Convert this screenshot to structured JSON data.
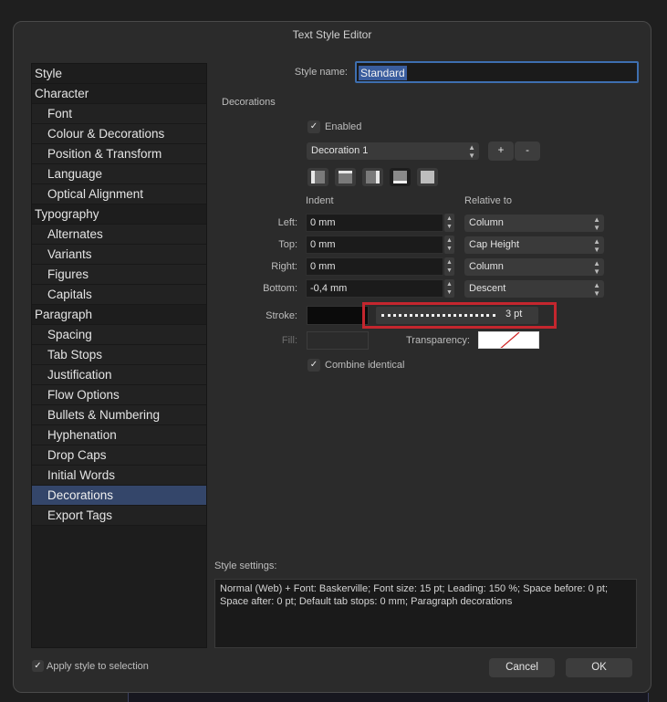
{
  "dialog": {
    "title": "Text Style Editor"
  },
  "sidebar": {
    "items": [
      {
        "label": "Style",
        "sub": false
      },
      {
        "label": "Character",
        "sub": false
      },
      {
        "label": "Font",
        "sub": true
      },
      {
        "label": "Colour & Decorations",
        "sub": true
      },
      {
        "label": "Position & Transform",
        "sub": true
      },
      {
        "label": "Language",
        "sub": true
      },
      {
        "label": "Optical Alignment",
        "sub": true
      },
      {
        "label": "Typography",
        "sub": false
      },
      {
        "label": "Alternates",
        "sub": true
      },
      {
        "label": "Variants",
        "sub": true
      },
      {
        "label": "Figures",
        "sub": true
      },
      {
        "label": "Capitals",
        "sub": true
      },
      {
        "label": "Paragraph",
        "sub": false
      },
      {
        "label": "Spacing",
        "sub": true
      },
      {
        "label": "Tab Stops",
        "sub": true
      },
      {
        "label": "Justification",
        "sub": true
      },
      {
        "label": "Flow Options",
        "sub": true
      },
      {
        "label": "Bullets & Numbering",
        "sub": true
      },
      {
        "label": "Hyphenation",
        "sub": true
      },
      {
        "label": "Drop Caps",
        "sub": true
      },
      {
        "label": "Initial Words",
        "sub": true
      },
      {
        "label": "Decorations",
        "sub": true,
        "selected": true
      },
      {
        "label": "Export Tags",
        "sub": true
      }
    ]
  },
  "style_name": {
    "label": "Style name:",
    "value": "Standard"
  },
  "decorations": {
    "section_label": "Decorations",
    "enabled_label": "Enabled",
    "enabled": true,
    "decoration_select": "Decoration 1",
    "add_label": "+",
    "remove_label": "-",
    "alignment_buttons": [
      "left",
      "top",
      "right",
      "bottom",
      "fill"
    ],
    "active_alignment": "bottom",
    "indent_header": "Indent",
    "relative_header": "Relative to",
    "rows": [
      {
        "label": "Left:",
        "value": "0 mm",
        "relative": "Column"
      },
      {
        "label": "Top:",
        "value": "0 mm",
        "relative": "Cap Height"
      },
      {
        "label": "Right:",
        "value": "0 mm",
        "relative": "Column"
      },
      {
        "label": "Bottom:",
        "value": "-0,4 mm",
        "relative": "Descent"
      }
    ],
    "stroke_label": "Stroke:",
    "stroke_color": "#000000",
    "stroke_width": "3 pt",
    "fill_label": "Fill:",
    "transparency_label": "Transparency:",
    "combine_label": "Combine identical",
    "combine": true
  },
  "style_settings": {
    "label": "Style settings:",
    "text": "Normal (Web) + Font: Baskerville; Font size: 15 pt; Leading: 150 %; Space before: 0 pt; Space after: 0 pt; Default tab stops: 0 mm; Paragraph decorations"
  },
  "footer": {
    "apply_label": "Apply style to selection",
    "apply_checked": true,
    "cancel_label": "Cancel",
    "ok_label": "OK"
  },
  "colors": {
    "highlight": "#c4262e",
    "selection": "#34466a",
    "accent_border": "#3e6fb0"
  }
}
